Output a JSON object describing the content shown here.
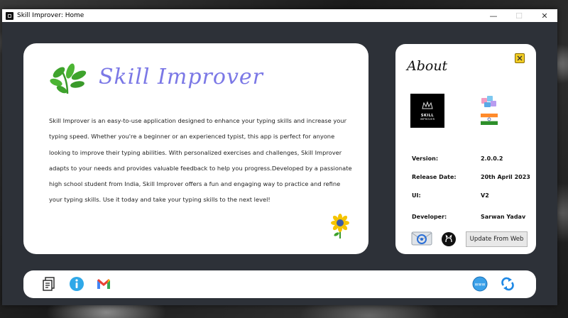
{
  "window": {
    "title": "Skill Improver: Home",
    "controls": {
      "minimize": "—",
      "maximize": "☐",
      "close": "✕"
    }
  },
  "main": {
    "brand": "Skill Improver",
    "description": "Skill Improver is an easy-to-use application designed to enhance your typing skills and increase your typing speed. Whether you're a beginner or an experienced typist, this app is perfect for anyone looking to improve their typing abilities. With personalized exercises and challenges, Skill Improver adapts to your needs and provides valuable feedback to help you progress.Developed by a passionate high school student from India, Skill Improver offers a fun and engaging way to practice and refine your typing skills. Use it today and take your typing skills to the next level!",
    "icons": {
      "logo": "leaf-sprig-icon",
      "decoration": "sunflower-icon"
    }
  },
  "about": {
    "title": "About",
    "logo_text": {
      "line1": "SKILL",
      "line2": "IMPROVER"
    },
    "rows": [
      {
        "label": "Version:",
        "value": "2.0.0.2"
      },
      {
        "label": "Release Date:",
        "value": "20th April 2023"
      },
      {
        "label": "UI:",
        "value": "V2"
      },
      {
        "label": "Developer:",
        "value": "Sarwan Yadav"
      }
    ],
    "update_button": "Update From Web",
    "icons": [
      "pin-icon",
      "pretty-ui-icon",
      "india-flag-icon",
      "mail-icon",
      "github-icon"
    ]
  },
  "bottom_bar": {
    "icons": [
      "notes-icon",
      "info-icon",
      "gmail-icon",
      "website-icon",
      "refresh-icon"
    ]
  },
  "colors": {
    "window_bg": "#2d3138",
    "brand": "#7b78e6",
    "accent_blue": "#2b8ae0"
  }
}
